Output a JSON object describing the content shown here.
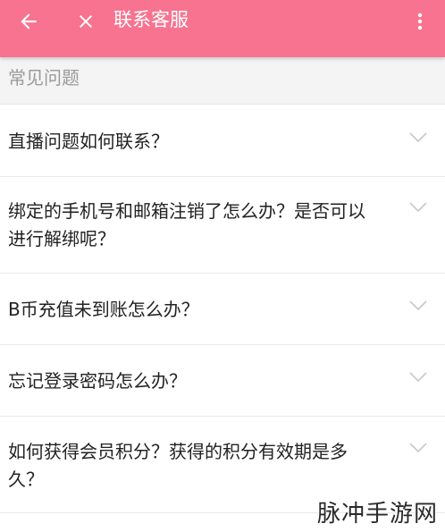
{
  "appbar": {
    "title": "联系客服",
    "back_icon": "arrow-left-icon",
    "close_icon": "close-icon",
    "more_icon": "more-vert-icon",
    "color": "#f7738f"
  },
  "section": {
    "title": "常见问题"
  },
  "faq": [
    {
      "question": "直播问题如何联系？"
    },
    {
      "question": "绑定的手机号和邮箱注销了怎么办？是否可以进行解绑呢？"
    },
    {
      "question": "B币充值未到账怎么办？"
    },
    {
      "question": "忘记登录密码怎么办？"
    },
    {
      "question": "如何获得会员积分？获得的积分有效期是多久？"
    }
  ],
  "watermark": "脉冲手游网"
}
